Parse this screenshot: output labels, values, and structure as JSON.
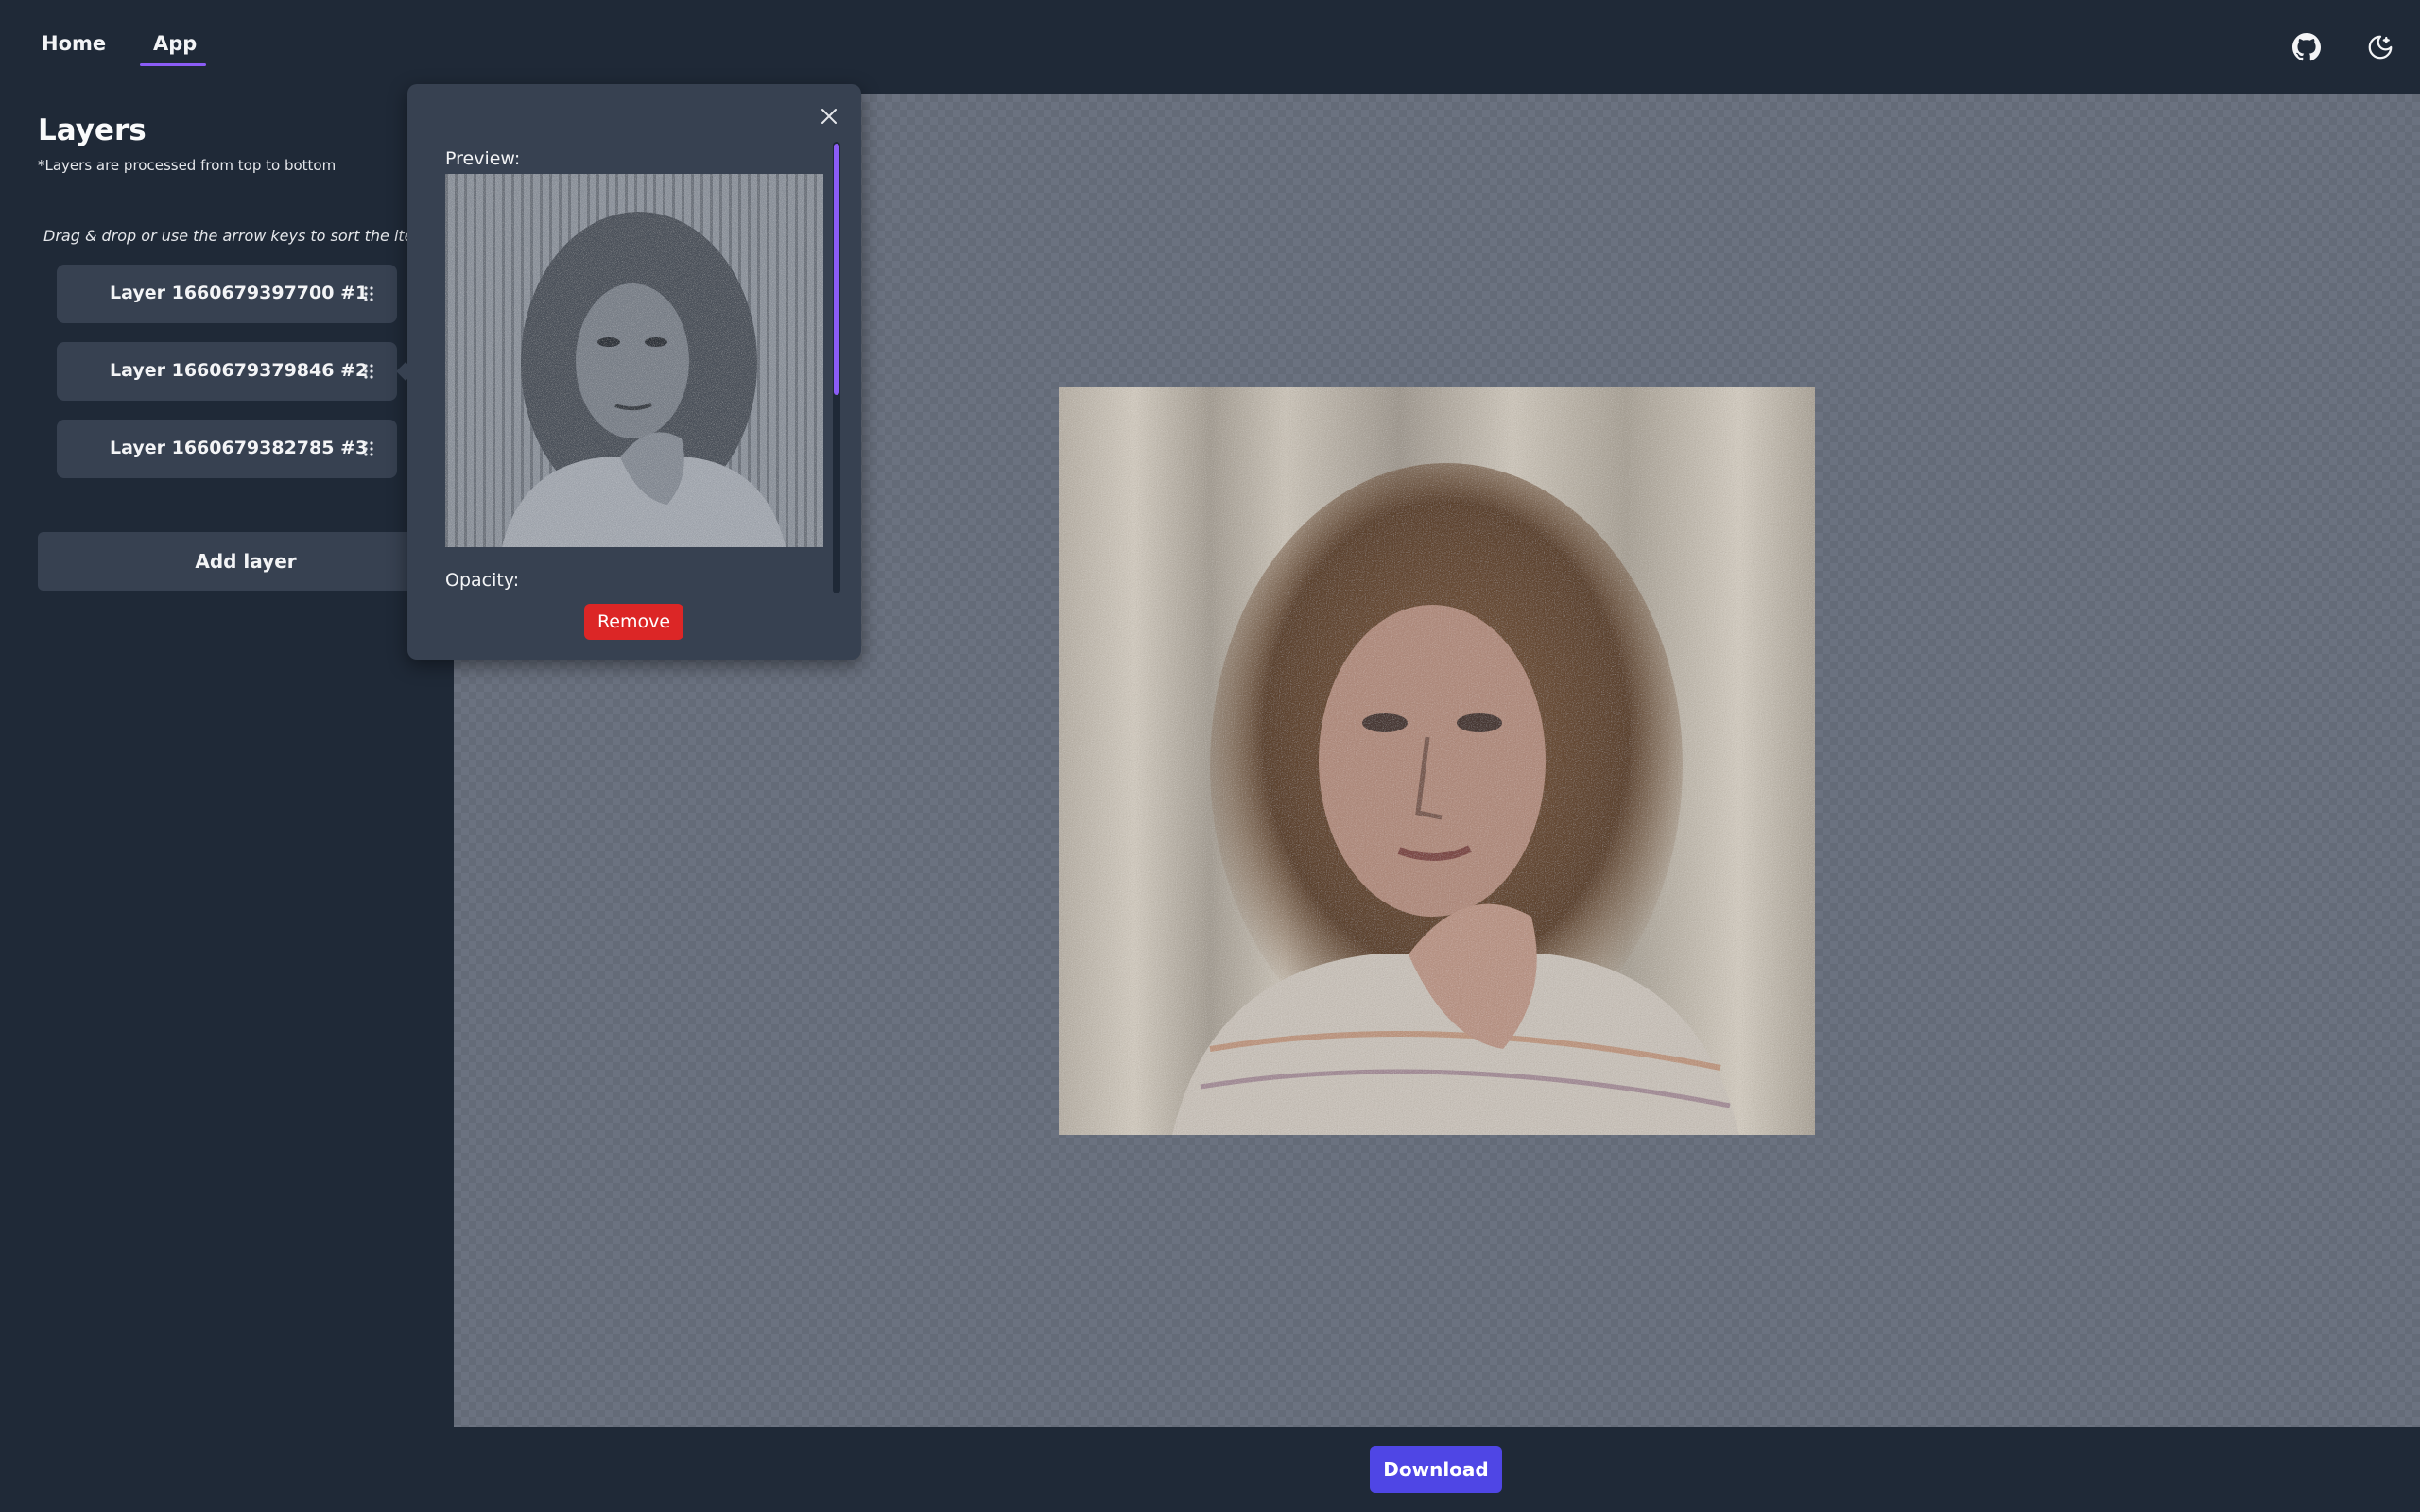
{
  "nav": {
    "home_label": "Home",
    "app_label": "App",
    "active_tab": "App",
    "accent_color": "#8b5cf6"
  },
  "header_icons": {
    "github": "github-icon",
    "theme": "moon-stars-icon"
  },
  "sidebar": {
    "title": "Layers",
    "subtitle": "*Layers are processed from top to bottom",
    "sort_hint": "Drag & drop or use the arrow keys to sort the items",
    "layers": [
      {
        "label": "Layer 1660679397700 #1"
      },
      {
        "label": "Layer 1660679379846 #2"
      },
      {
        "label": "Layer 1660679382785 #3"
      }
    ],
    "add_layer_label": "Add layer"
  },
  "popover": {
    "preview_label": "Preview:",
    "opacity_label": "Opacity:",
    "remove_label": "Remove",
    "remove_color": "#dc2626",
    "close_icon": "close-icon"
  },
  "canvas": {
    "image_description_icon": "portrait-image"
  },
  "footer": {
    "download_label": "Download",
    "download_color": "#4f46e5"
  }
}
